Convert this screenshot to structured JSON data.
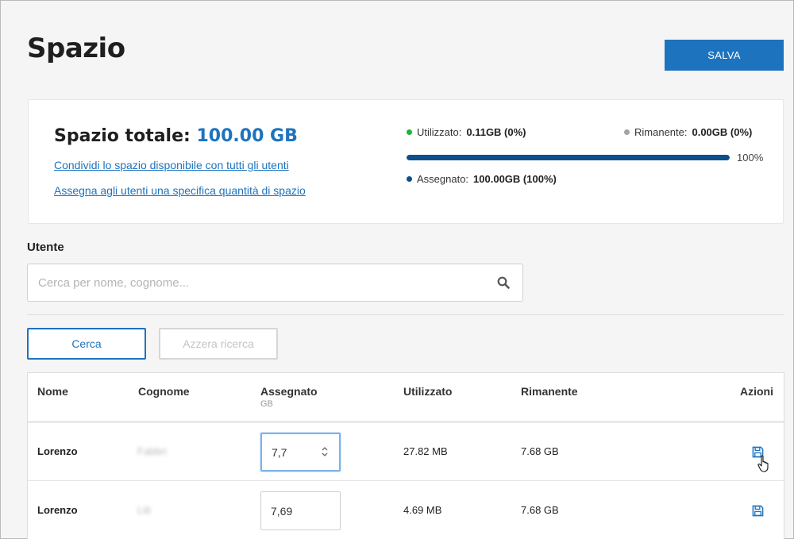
{
  "page": {
    "title": "Spazio",
    "save_label": "SALVA"
  },
  "summary": {
    "total_label": "Spazio totale:",
    "total_value": "100.00 GB",
    "link_share": "Condividi lo spazio disponibile con tutti gli utenti",
    "link_assign": "Assegna agli utenti una specifica quantità di spazio",
    "used_label": "Utilizzato:",
    "used_value": "0.11GB (0%)",
    "remaining_label": "Rimanente:",
    "remaining_value": "0.00GB (0%)",
    "assigned_label": "Assegnato:",
    "assigned_value": "100.00GB (100%)",
    "progress_percent": 100,
    "progress_label": "100%",
    "colors": {
      "used": "#22b33a",
      "remaining": "#a3a3a3",
      "assigned": "#0d4f8b",
      "progress": "#0d4f8b",
      "accent": "#1e73be"
    }
  },
  "filter": {
    "label": "Utente",
    "placeholder": "Cerca per nome, cognome...",
    "search_button": "Cerca",
    "reset_button": "Azzera ricerca"
  },
  "table": {
    "headers": {
      "name": "Nome",
      "surname": "Cognome",
      "assigned": "Assegnato",
      "assigned_unit": "GB",
      "used": "Utilizzato",
      "remaining": "Rimanente",
      "actions": "Azioni"
    },
    "rows": [
      {
        "name": "Lorenzo",
        "surname": "Fabbri",
        "assigned": "7,7",
        "used": "27.82 MB",
        "remaining": "7.68 GB",
        "action_icon": "save-icon"
      },
      {
        "name": "Lorenzo",
        "surname": "Liti",
        "assigned": "7,69",
        "used": "4.69 MB",
        "remaining": "7.68 GB",
        "action_icon": "save-icon"
      }
    ]
  }
}
